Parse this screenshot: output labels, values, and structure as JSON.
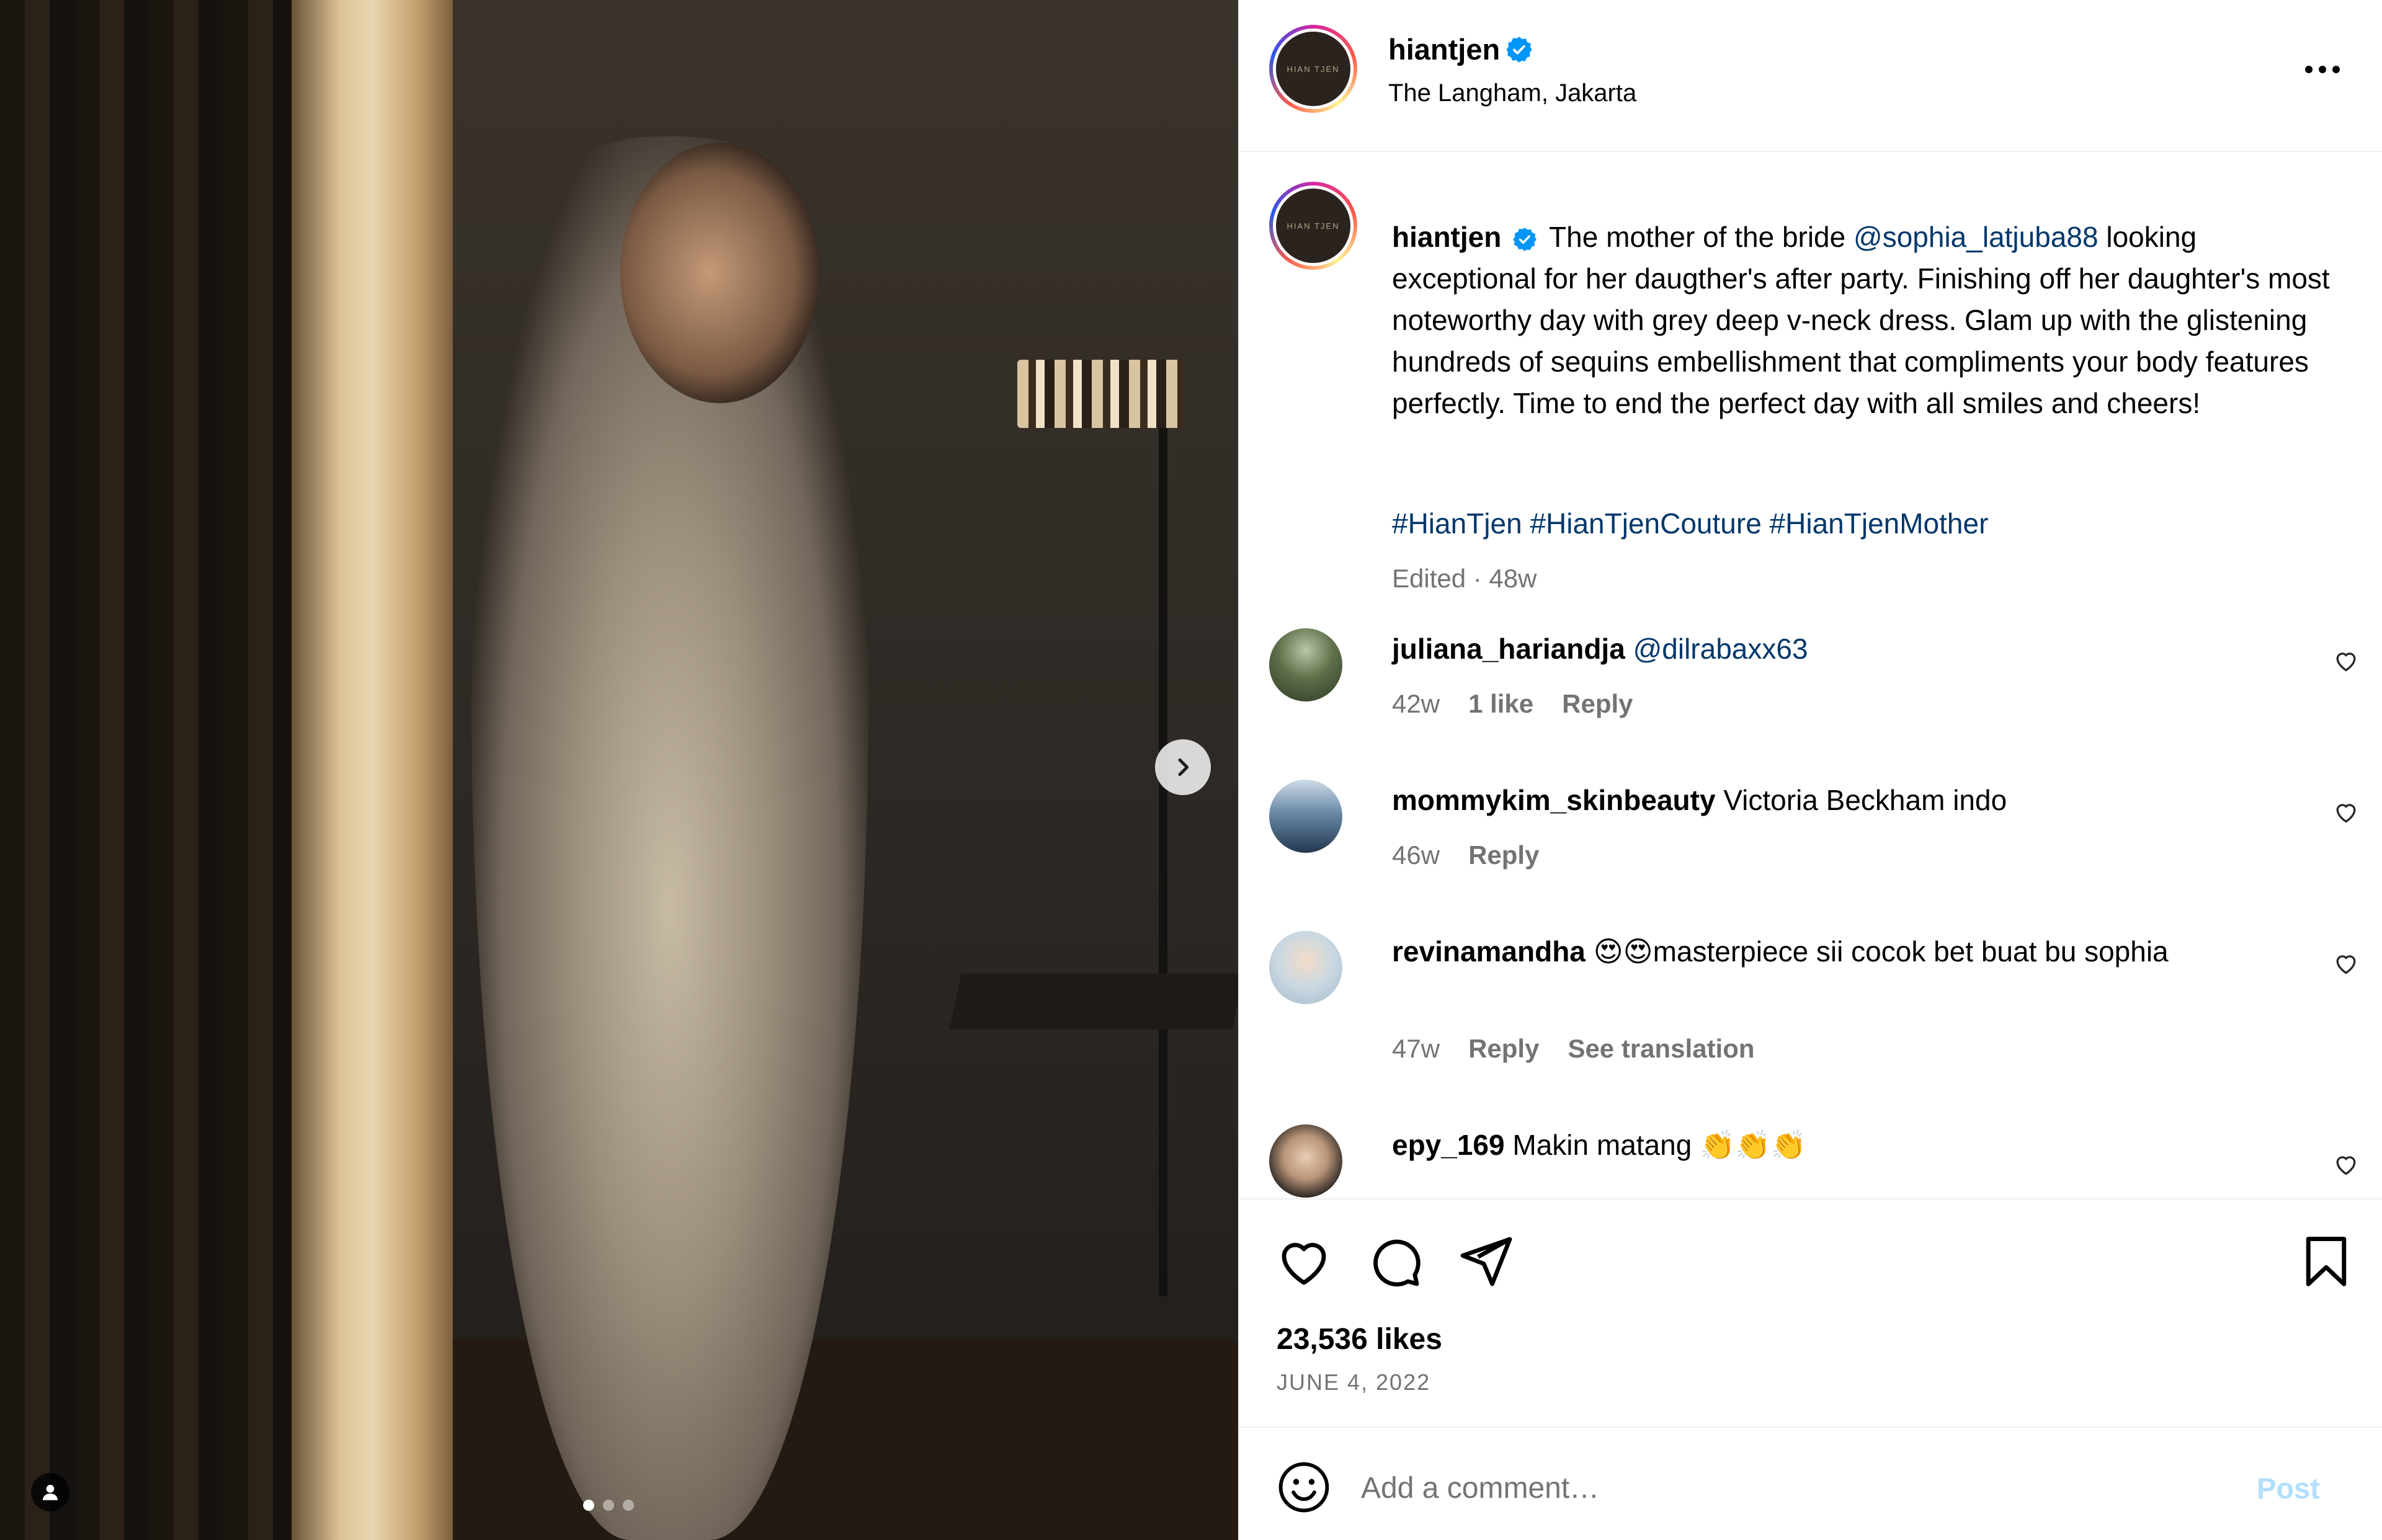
{
  "post": {
    "username": "hiantjen",
    "location": "The Langham, Jakarta",
    "avatar_logo_text": "HIAN TJEN",
    "caption": {
      "username": "hiantjen",
      "text_before_mention": "The mother of the bride",
      "mention": "@sophia_latjuba88",
      "text_after_mention": "looking exceptional for her daugther's after party. Finishing off her daughter's most noteworthy day with grey deep v-neck dress. Glam up with the glistening hundreds of sequins embellishment that compliments your body features perfectly. Time to end the perfect day with all smiles and cheers!",
      "hashtags": "#HianTjen #HianTjenCouture #HianTjenMother",
      "meta": "Edited · 48w"
    },
    "likes": "23,536 likes",
    "date": "JUNE 4, 2022",
    "carousel": {
      "total": 3,
      "active_index": 0
    }
  },
  "comments": [
    {
      "username": "juliana_hariandja",
      "mention": "@dilrabaxx63",
      "text": "",
      "time": "42w",
      "likes": "1 like",
      "reply": "Reply",
      "translate": ""
    },
    {
      "username": "mommykim_skinbeauty",
      "mention": "",
      "text": "Victoria Beckham indo",
      "time": "46w",
      "likes": "",
      "reply": "Reply",
      "translate": ""
    },
    {
      "username": "revinamandha",
      "mention": "",
      "text": "😍😍masterpiece sii cocok bet buat bu sophia",
      "time": "47w",
      "likes": "",
      "reply": "Reply",
      "translate": "See translation"
    },
    {
      "username": "epy_169",
      "mention": "",
      "text": "Makin matang 👏👏👏",
      "time": "",
      "likes": "",
      "reply": "",
      "translate": ""
    }
  ],
  "composer": {
    "placeholder": "Add a comment…",
    "post_label": "Post"
  },
  "colors": {
    "link": "#00376b",
    "muted": "#737373",
    "verified": "#0095f6",
    "post_disabled": "#b2dffc"
  },
  "icons": [
    "verified-badge-icon",
    "more-options-icon",
    "next-arrow-icon",
    "tagged-user-icon",
    "like-heart-icon",
    "comment-bubble-icon",
    "share-paper-plane-icon",
    "save-bookmark-icon",
    "emoji-icon"
  ]
}
